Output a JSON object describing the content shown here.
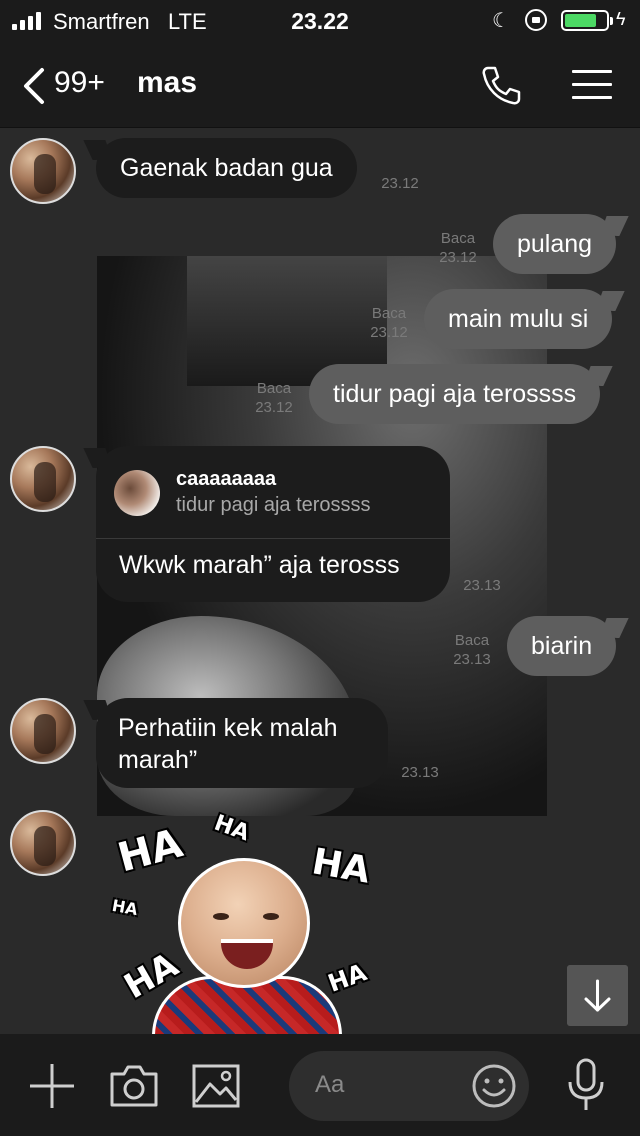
{
  "status_bar": {
    "carrier": "Smartfren",
    "network": "LTE",
    "time": "23.22",
    "battery_level": 0.78
  },
  "header": {
    "unread_count": "99+",
    "contact_name": "mas"
  },
  "messages": [
    {
      "id": "m1",
      "dir": "in",
      "text": "Gaenak badan gua",
      "time": "23.12"
    },
    {
      "id": "m2",
      "dir": "out",
      "text": "pulang",
      "read": "Baca",
      "time": "23.12"
    },
    {
      "id": "m3",
      "dir": "out",
      "text": "main mulu si",
      "read": "Baca",
      "time": "23.12"
    },
    {
      "id": "m4",
      "dir": "out",
      "text": "tidur pagi aja terossss",
      "read": "Baca",
      "time": "23.12"
    },
    {
      "id": "m5",
      "dir": "in",
      "reply_to_name": "caaaaaaaa",
      "reply_to_text": "tidur pagi aja terossss",
      "text": "Wkwk marah” aja terosss",
      "time": "23.13"
    },
    {
      "id": "m6",
      "dir": "out",
      "text": "biarin",
      "read": "Baca",
      "time": "23.13"
    },
    {
      "id": "m7",
      "dir": "in",
      "text": "Perhatiin kek malah marah”",
      "time": "23.13"
    },
    {
      "id": "m8",
      "dir": "in",
      "sticker": "HA",
      "sticker_label": "laughing-baby-sticker"
    }
  ],
  "input": {
    "placeholder": "Aa"
  },
  "icons": {
    "add": "plus-icon",
    "camera": "camera-icon",
    "gallery": "image-icon",
    "emoji": "emoji-icon",
    "mic": "microphone-icon",
    "scroll": "arrow-down-icon"
  },
  "colors": {
    "background": "#2a2a2a",
    "bar": "#1b1b1b",
    "incoming_bubble": "#1c1c1c",
    "outgoing_bubble": "#5e5e5e",
    "battery": "#4cd964"
  }
}
